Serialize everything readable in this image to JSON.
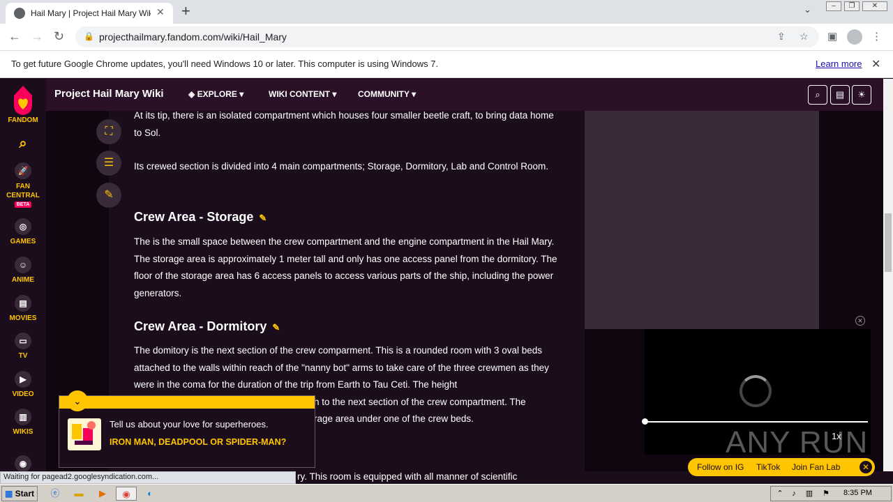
{
  "browser": {
    "tab_title": "Hail Mary | Project Hail Mary Wiki | F",
    "new_tab": "+",
    "url": "projecthailmary.fandom.com/wiki/Hail_Mary",
    "info_bar": {
      "text": "To get future Google Chrome updates, you'll need Windows 10 or later. This computer is using Windows 7.",
      "link": "Learn more"
    },
    "status_text": "Waiting for pagead2.googlesyndication.com..."
  },
  "rail": {
    "logo": "FANDOM",
    "items": [
      {
        "label": "FAN\nCENTRAL",
        "icon": "rocket-icon",
        "badge": "BETA"
      },
      {
        "label": "GAMES",
        "icon": "gamepad-icon"
      },
      {
        "label": "ANIME",
        "icon": "anime-face-icon"
      },
      {
        "label": "MOVIES",
        "icon": "clapper-icon"
      },
      {
        "label": "TV",
        "icon": "tv-icon"
      },
      {
        "label": "VIDEO",
        "icon": "play-icon"
      },
      {
        "label": "WIKIS",
        "icon": "book-icon"
      }
    ]
  },
  "wiki_header": {
    "name": "Project Hail Mary Wiki",
    "nav": [
      "EXPLORE",
      "WIKI CONTENT",
      "COMMUNITY"
    ]
  },
  "article": {
    "p1": "At its tip, there is an isolated compartment which houses four smaller beetle craft, to bring data home to Sol.",
    "p2": "Its crewed section is divided into 4 main compartments; Storage, Dormitory, Lab and Control Room.",
    "h_storage": "Crew Area - Storage",
    "p3": "The is the small space between the crew compartment and the engine compartment in the Hail Mary. The storage area is approximately 1 meter tall and only has one access panel from the dormitory. The floor of the storage area has 6 access panels to access various parts of the ship, including the power generators.",
    "h_dorm": "Crew Area - Dormitory",
    "p4a": "The domitory is the next section of the crew comparment. This is a rounded room with 3 oval beds attached to the walls within reach of the \"nanny bot\" arms to take care of the three crewmen as they were in the coma for the duration of the trip from Earth to Tau Ceti. The height",
    "p4b": "h to the next section of the crew compartment. The",
    "p4c": "rage area under one of the crew beds.",
    "p5": "ry. This room is equipped with all manner of scientific"
  },
  "popup": {
    "text": "Tell us about your love for superheroes.",
    "question": "IRON MAN, DEADPOOL OR SPIDER-MAN?"
  },
  "video": {
    "speed": "1x",
    "watermark": "ANY RUN"
  },
  "social": {
    "items": [
      "Follow on IG",
      "TikTok",
      "Join Fan Lab"
    ]
  },
  "taskbar": {
    "start": "Start",
    "clock": "8:35 PM"
  },
  "colors": {
    "accent": "#ffc500",
    "page_bg": "#1b0d1b",
    "header_bg": "#2a1128"
  }
}
